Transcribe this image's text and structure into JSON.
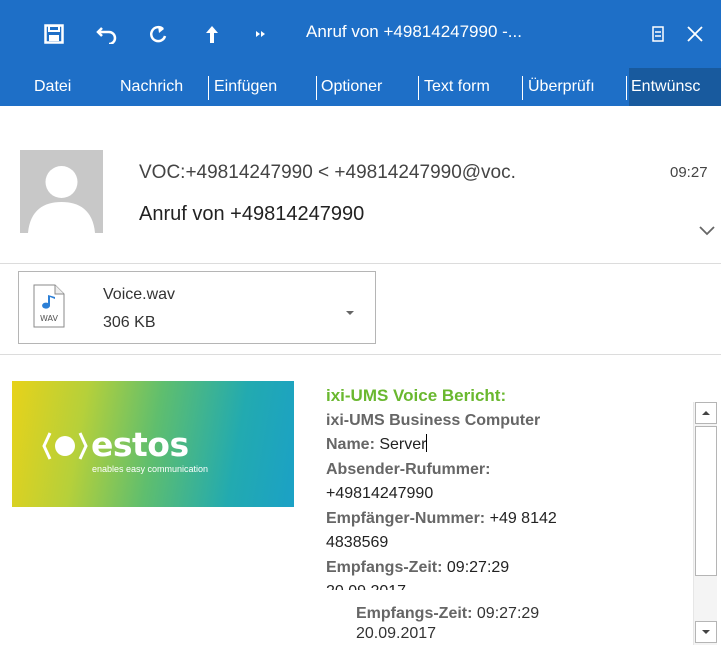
{
  "window": {
    "title": "Anruf von +49814247990 -...",
    "icons": [
      "save-icon",
      "undo-icon",
      "redo-icon",
      "up-icon",
      "more-icon",
      "restore-icon",
      "close-icon"
    ]
  },
  "ribbon": {
    "tabs": [
      "Datei",
      "Nachrich",
      "Einfügen",
      "Optioner",
      "Text form",
      "Überprüfı",
      "Entwünsc"
    ]
  },
  "message": {
    "sender": "VOC:+49814247990 < +49814247990@voc.",
    "time": "09:27",
    "subject": "Anruf von +49814247990"
  },
  "attachment": {
    "name": "Voice.wav",
    "size": "306 KB",
    "type_label": "WAV"
  },
  "logo": {
    "name": "estos",
    "tagline": "enables easy communication"
  },
  "report": {
    "heading": "ixi-UMS Voice Bericht:",
    "line1": "ixi-UMS Business Computer",
    "name_label": "Name:",
    "name_value": "Server",
    "sender_label": "Absender-Rufummer:",
    "sender_value": "+49814247990",
    "recipient_label": "Empfänger-Nummer:",
    "recipient_value_1": "+49 8142",
    "recipient_value_2": "4838569",
    "time_label": "Empfangs-Zeit:",
    "time_value": "09:27:29",
    "date_value": "20.09.2017"
  },
  "colors": {
    "titlebar": "#1e6fc7",
    "accent_green": "#6ab82f"
  }
}
